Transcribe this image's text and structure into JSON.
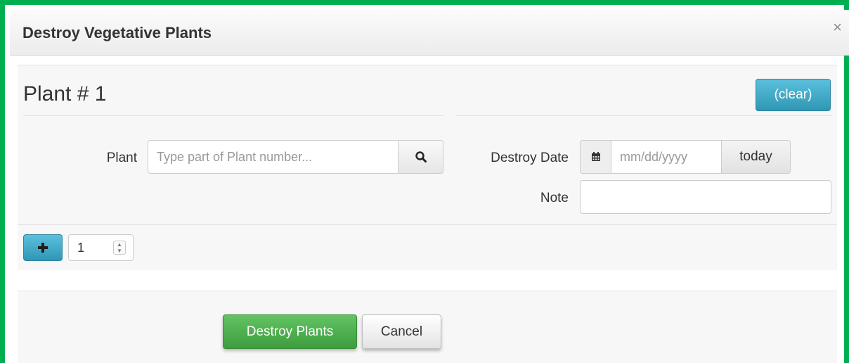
{
  "modal": {
    "title": "Destroy Vegetative Plants",
    "close_icon": "close-icon",
    "close_glyph": "×"
  },
  "plant_section": {
    "heading": "Plant # 1",
    "clear_label": "(clear)",
    "plant_label": "Plant",
    "plant_placeholder": "Type part of Plant number...",
    "search_icon": "search-icon",
    "destroy_date_label": "Destroy Date",
    "calendar_icon": "calendar-icon",
    "date_placeholder": "mm/dd/yyyy",
    "today_label": "today",
    "note_label": "Note",
    "note_value": ""
  },
  "add_row": {
    "plus_icon": "plus-icon",
    "quantity": "1"
  },
  "footer": {
    "destroy_label": "Destroy Plants",
    "cancel_label": "Cancel"
  },
  "colors": {
    "frame_border": "#00b050",
    "info_button": "#5bc0de",
    "success_button": "#5cb85c"
  }
}
